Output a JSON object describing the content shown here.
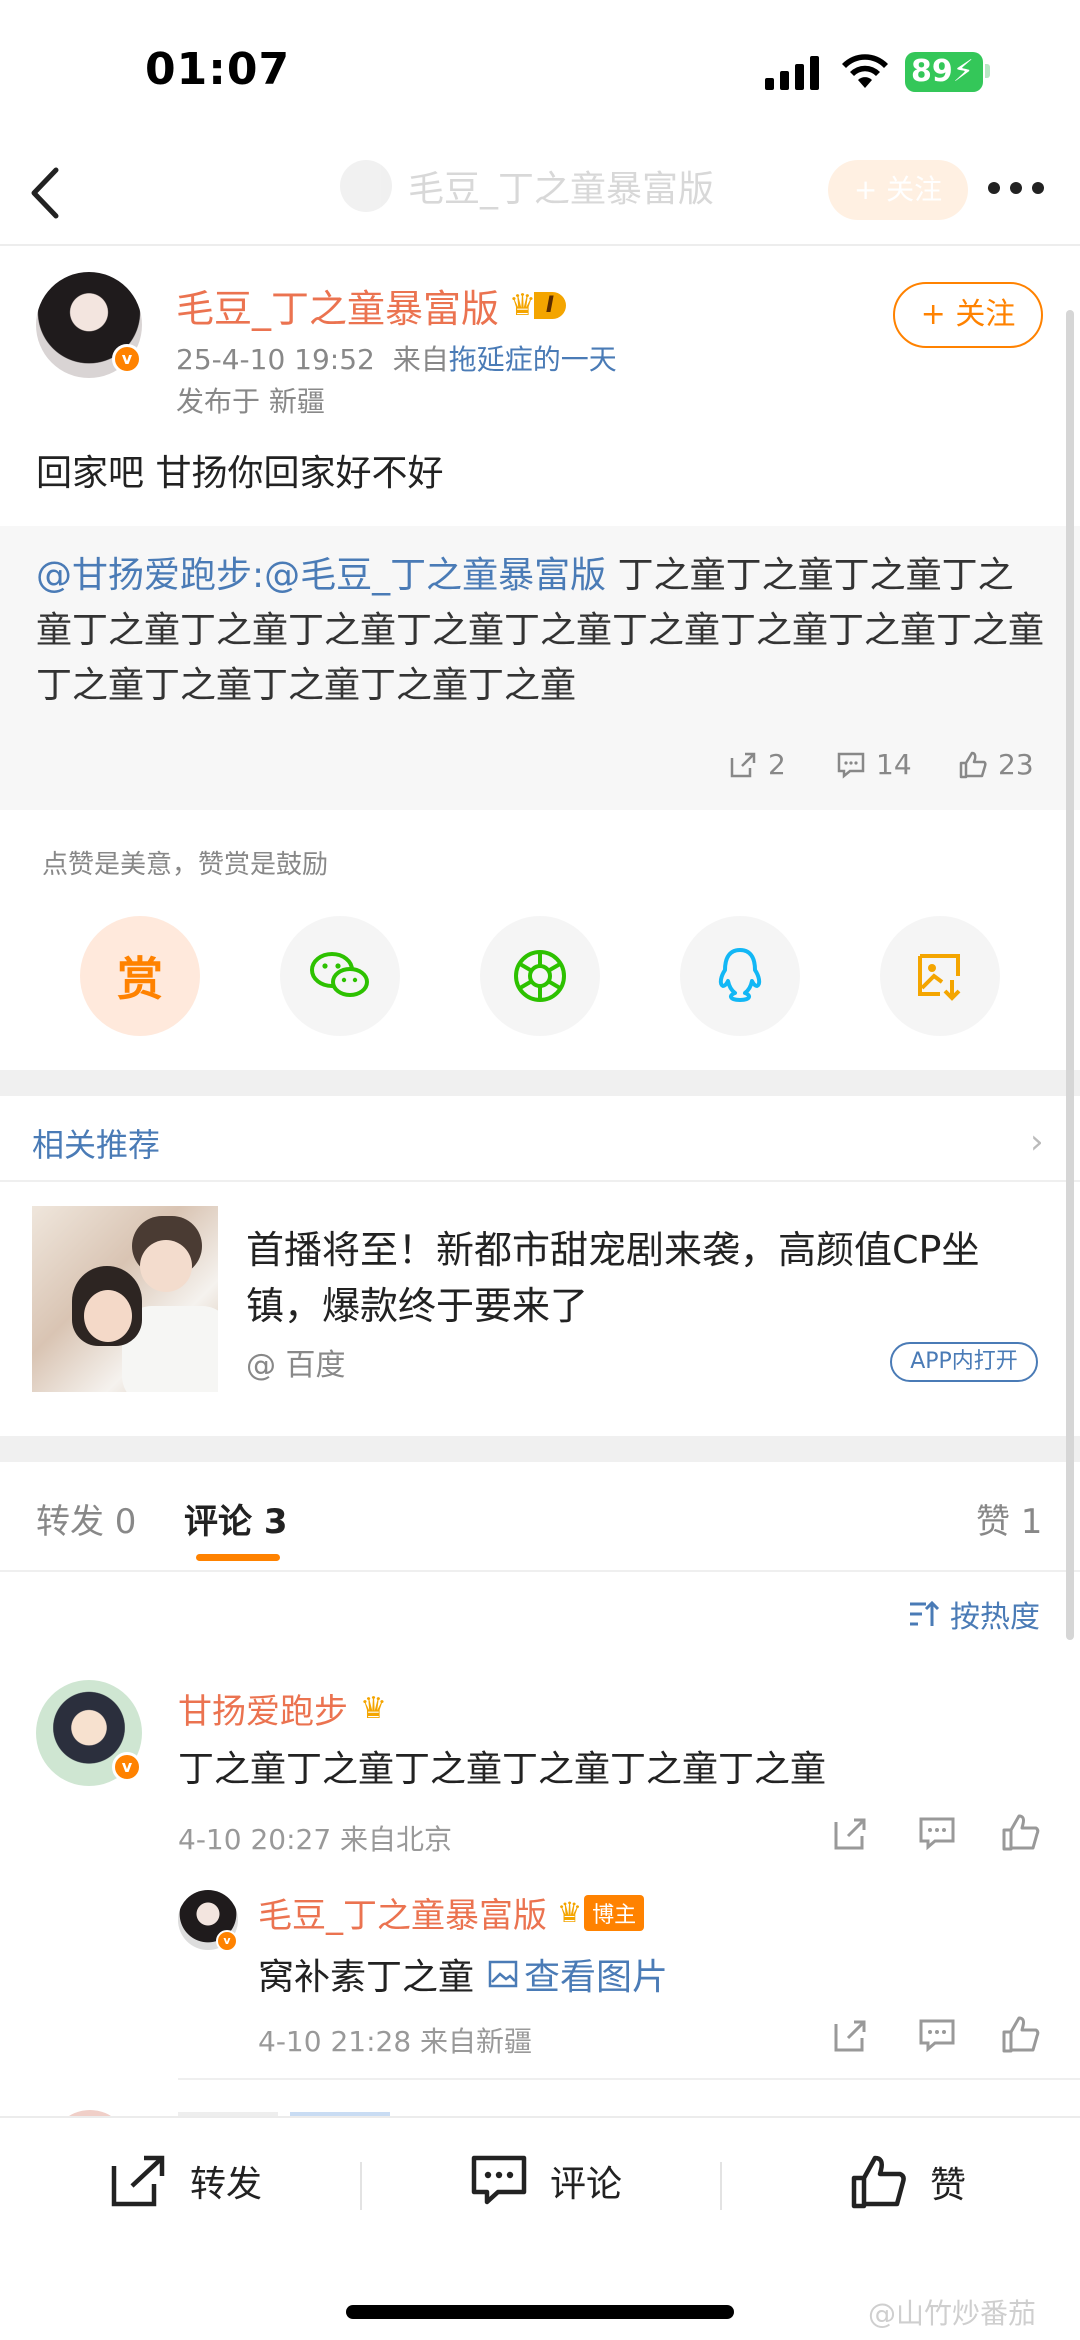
{
  "status_bar": {
    "time": "01:07",
    "battery": "89"
  },
  "nav": {
    "ghost_title": "毛豆_丁之童暴富版",
    "ghost_follow": "+ 关注"
  },
  "post": {
    "author": "毛豆_丁之童暴富版",
    "level": "I",
    "date": "25-4-10 19:52",
    "source_prefix": "来自",
    "source": "拖延症的一天",
    "location": "发布于 新疆",
    "follow_label": "+ 关注",
    "text": "回家吧 甘扬你回家好不好"
  },
  "repost": {
    "mention": "@甘扬爱跑步:@毛豆_丁之童暴富版",
    "body": " 丁之童丁之童丁之童丁之童丁之童丁之童丁之童丁之童丁之童丁之童丁之童丁之童丁之童丁之童丁之童丁之童丁之童丁之童",
    "reposts": "2",
    "comments": "14",
    "likes": "23"
  },
  "reward": {
    "tip": "点赞是美意，赞赏是鼓励",
    "reward_glyph": "赏"
  },
  "related": {
    "title": "相关推荐",
    "headline": "首播将至！新都市甜宠剧来袭，高颜值CP坐镇，爆款终于要来了",
    "source": "@ 百度",
    "open_label": "APP内打开"
  },
  "tabs": {
    "repost": "转发 0",
    "comment": "评论 3",
    "like": "赞 1"
  },
  "sort_label": "按热度",
  "comments": [
    {
      "name": "甘扬爱跑步",
      "text": "丁之童丁之童丁之童丁之童丁之童丁之童",
      "meta": "4-10 20:27  来自北京"
    }
  ],
  "reply": {
    "name": "毛豆_丁之童暴富版",
    "badge": "博主",
    "text": "窝补素丁之童",
    "image_link": "查看图片",
    "meta": "4-10 21:28  来自新疆"
  },
  "bottom_bar": {
    "repost": "转发",
    "comment": "评论",
    "like": "赞"
  },
  "watermark": "@山竹炒番茄",
  "colors": {
    "accent": "#ff8200",
    "name": "#eb7350",
    "link": "#4a7bb6"
  }
}
